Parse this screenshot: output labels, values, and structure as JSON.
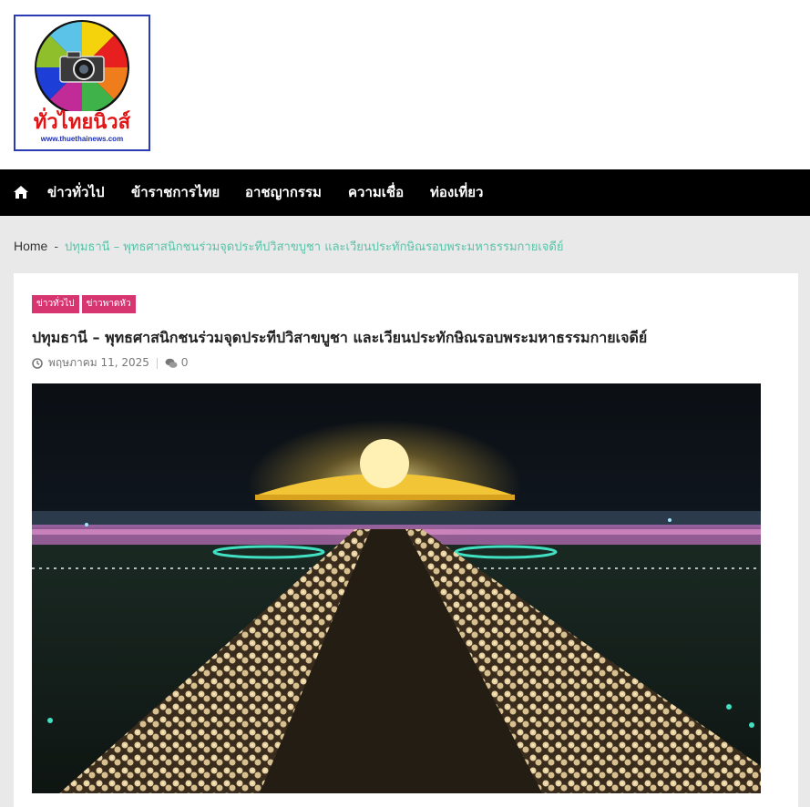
{
  "logo": {
    "title": "ทั่วไทยนิวส์",
    "url": "www.thuethainews.com",
    "icon": "camera-aperture-logo"
  },
  "nav": {
    "home_icon": "home-icon",
    "items": [
      "ข่าวทั่วไป",
      "ข้าราชการไทย",
      "อาชญากรรม",
      "ความเชื่อ",
      "ท่องเที่ยว"
    ]
  },
  "breadcrumb": {
    "home": "Home",
    "separator": "-",
    "current": "ปทุมธานี – พุทธศาสนิกชนร่วมจุดประทีปวิสาขบูชา และเวียนประทักษิณรอบพระมหาธรรมกายเจดีย์"
  },
  "post": {
    "tags": [
      "ข่าวทั่วไป",
      "ข่าวพาดหัว"
    ],
    "title": "ปทุมธานี – พุทธศาสนิกชนร่วมจุดประทีปวิสาขบูชา และเวียนประทักษิณรอบพระมหาธรรมกายเจดีย์",
    "date": "พฤษภาคม 11, 2025",
    "comments": "0",
    "date_icon": "clock-icon",
    "comments_icon": "comments-icon"
  },
  "colors": {
    "nav_bg": "#000000",
    "tag_bg": "#d6356f",
    "breadcrumb_current": "#5bc2a8",
    "page_bg": "#e9e9e9"
  }
}
